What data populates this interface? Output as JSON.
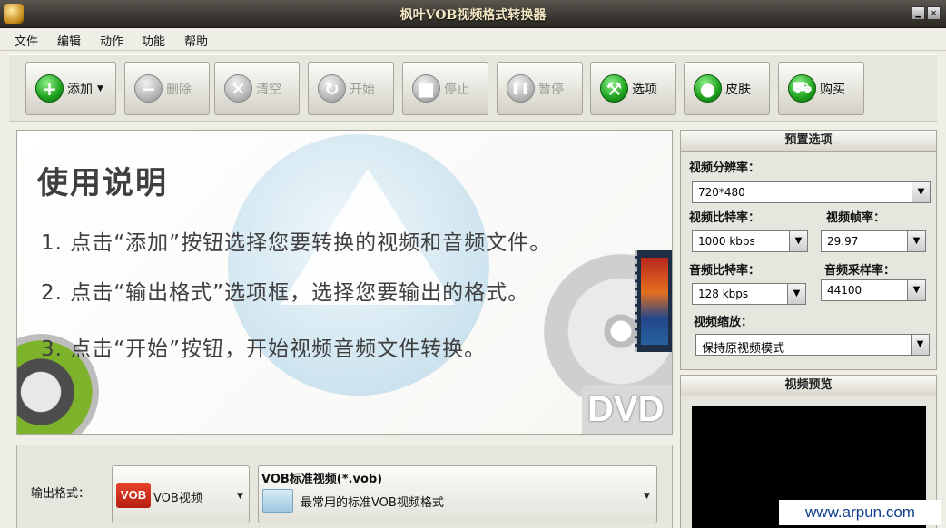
{
  "window": {
    "title": "枫叶VOB视频格式转换器",
    "minimize_glyph": "▁",
    "close_glyph": "✕"
  },
  "menu": [
    "文件",
    "编辑",
    "动作",
    "功能",
    "帮助"
  ],
  "toolbar": {
    "add": {
      "label": "添加",
      "icon": "plus-icon",
      "glyph": "+",
      "arrow": "▼"
    },
    "delete": {
      "label": "删除",
      "icon": "minus-icon",
      "glyph": "−"
    },
    "clear": {
      "label": "清空",
      "icon": "broom-icon",
      "glyph": "✕"
    },
    "start": {
      "label": "开始",
      "icon": "refresh-icon",
      "glyph": "↻"
    },
    "stop": {
      "label": "停止",
      "icon": "stop-icon",
      "glyph": "■"
    },
    "pause": {
      "label": "暂停",
      "icon": "pause-icon",
      "glyph": "❚❚"
    },
    "options": {
      "label": "选项",
      "icon": "tools-icon",
      "glyph": "⚒"
    },
    "skin": {
      "label": "皮肤",
      "icon": "apple-icon",
      "glyph": "●"
    },
    "buy": {
      "label": "购买",
      "icon": "cart-icon",
      "glyph": "⛟"
    }
  },
  "instructions": {
    "title": "使用说明",
    "steps": [
      "1. 点击“添加”按钮选择您要转换的视频和音频文件。",
      "2. 点击“输出格式”选项框，选择您要输出的格式。",
      "3. 点击“开始”按钮，开始视频音频文件转换。"
    ],
    "dvd_text": "DVD"
  },
  "output": {
    "label": "输出格式：",
    "format_badge": "VOB",
    "format_short": "VOB视频",
    "format_name": "VOB标准视频(*.vob)",
    "format_desc": "最常用的标准VOB视频格式",
    "arrow": "▼"
  },
  "presets": {
    "header": "预置选项",
    "resolution": {
      "label": "视频分辨率：",
      "value": "720*480"
    },
    "video_bitrate": {
      "label": "视频比特率：",
      "value": "1000 kbps"
    },
    "frame_rate": {
      "label": "视频帧率：",
      "value": "29.97"
    },
    "audio_bitrate": {
      "label": "音频比特率：",
      "value": "128 kbps"
    },
    "sample_rate": {
      "label": "音频采样率：",
      "value": "44100"
    },
    "scaling": {
      "label": "视频缩放：",
      "value": "保持原视频模式"
    },
    "combo_arrow": "▼"
  },
  "preview": {
    "header": "视频预览"
  },
  "watermark": "www.arpun.com",
  "colors": {
    "add_icon": "#1ea21d",
    "disabled_icon": "#b8b8b8",
    "preview_screen": "#000000",
    "watermark_text": "#0f3f8c"
  }
}
